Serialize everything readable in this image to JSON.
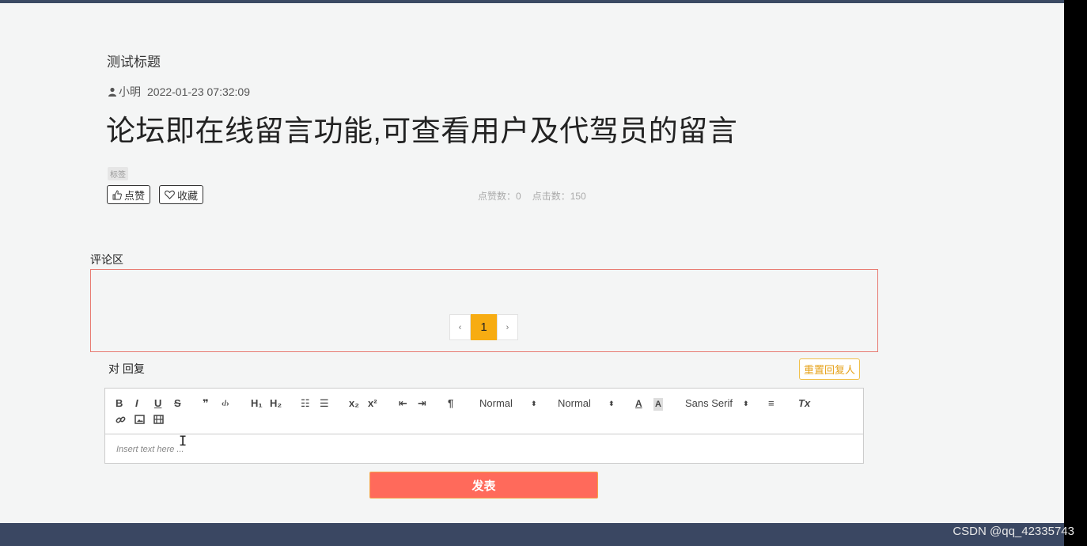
{
  "post": {
    "subtitle": "测试标题",
    "author": "小明",
    "date": "2022-01-23 07:32:09",
    "title": "论坛即在线留言功能,可查看用户及代驾员的留言",
    "tag": "标签",
    "like_label": "点赞",
    "favorite_label": "收藏",
    "likes_text": "点赞数：0",
    "clicks_text": "点击数：150"
  },
  "comments": {
    "label": "评论区",
    "pagination": {
      "prev": "‹",
      "current": "1",
      "next": "›"
    }
  },
  "reply": {
    "label": "对 回复",
    "reset_label": "重置回复人"
  },
  "editor": {
    "toolbar": {
      "bold": "B",
      "italic": "I",
      "underline": "U",
      "strike": "S",
      "blockquote": "❞",
      "code": "‹/›",
      "h1": "H₁",
      "h2": "H₂",
      "ordered_list": "☷",
      "bullet_list": "☰",
      "subscript": "x₂",
      "superscript": "x²",
      "outdent": "⇤",
      "indent": "⇥",
      "direction": "¶",
      "size_picker": "Normal",
      "header_picker": "Normal",
      "color": "A",
      "background": "A",
      "font_picker": "Sans Serif",
      "align": "≡",
      "clean": "Tx",
      "link": "🔗",
      "image": "▣",
      "video": "▦"
    },
    "placeholder": "Insert text here ..."
  },
  "submit_label": "发表",
  "watermark": "CSDN @qq_42335743",
  "colors": {
    "accent": "#f7ac12",
    "submit": "#ff6a5b",
    "comment_border": "#e87b72",
    "topbar": "#3b4a63"
  }
}
